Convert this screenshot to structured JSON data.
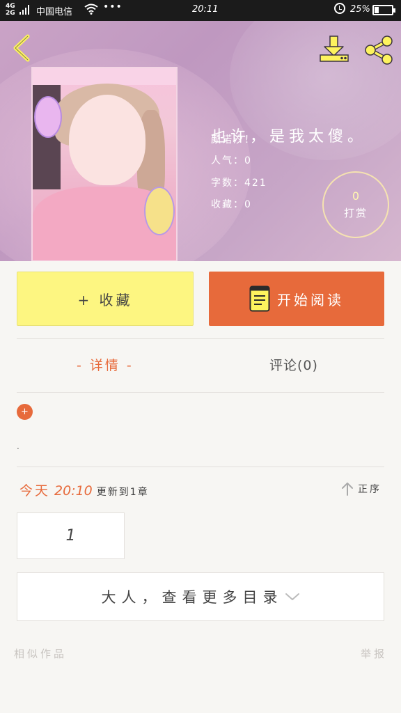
{
  "status_bar": {
    "network": "4G\n2G",
    "carrier": "中国电信",
    "time": "20:11",
    "battery": "25%"
  },
  "header": {
    "icons": [
      "back-arrow-icon",
      "download-icon",
      "share-icon"
    ]
  },
  "book": {
    "title": "也许，是我太傻。",
    "author": "颜诺汐！",
    "popularity": "人气：0",
    "word_count": "字数：421",
    "favorites": "收藏：0",
    "reward_count": "0",
    "reward_label": "打赏"
  },
  "actions": {
    "favorite_label": "+ 收藏",
    "read_label": "开始阅读"
  },
  "tabs": {
    "detail": "- 详情 -",
    "comments": "评论(0)"
  },
  "detail": {
    "expand_icon": "+",
    "description": "."
  },
  "update": {
    "day": "今天",
    "time": "20:10",
    "note": "更新到1章",
    "sort_label": "正序"
  },
  "chapters": [
    "1"
  ],
  "more_label": "大人，查看更多目录",
  "footer": {
    "similar": "相似作品",
    "report": "举报"
  },
  "colors": {
    "accent": "#e76a3b",
    "favorite_bg": "#fdf681",
    "page_bg": "#f7f6f3"
  }
}
